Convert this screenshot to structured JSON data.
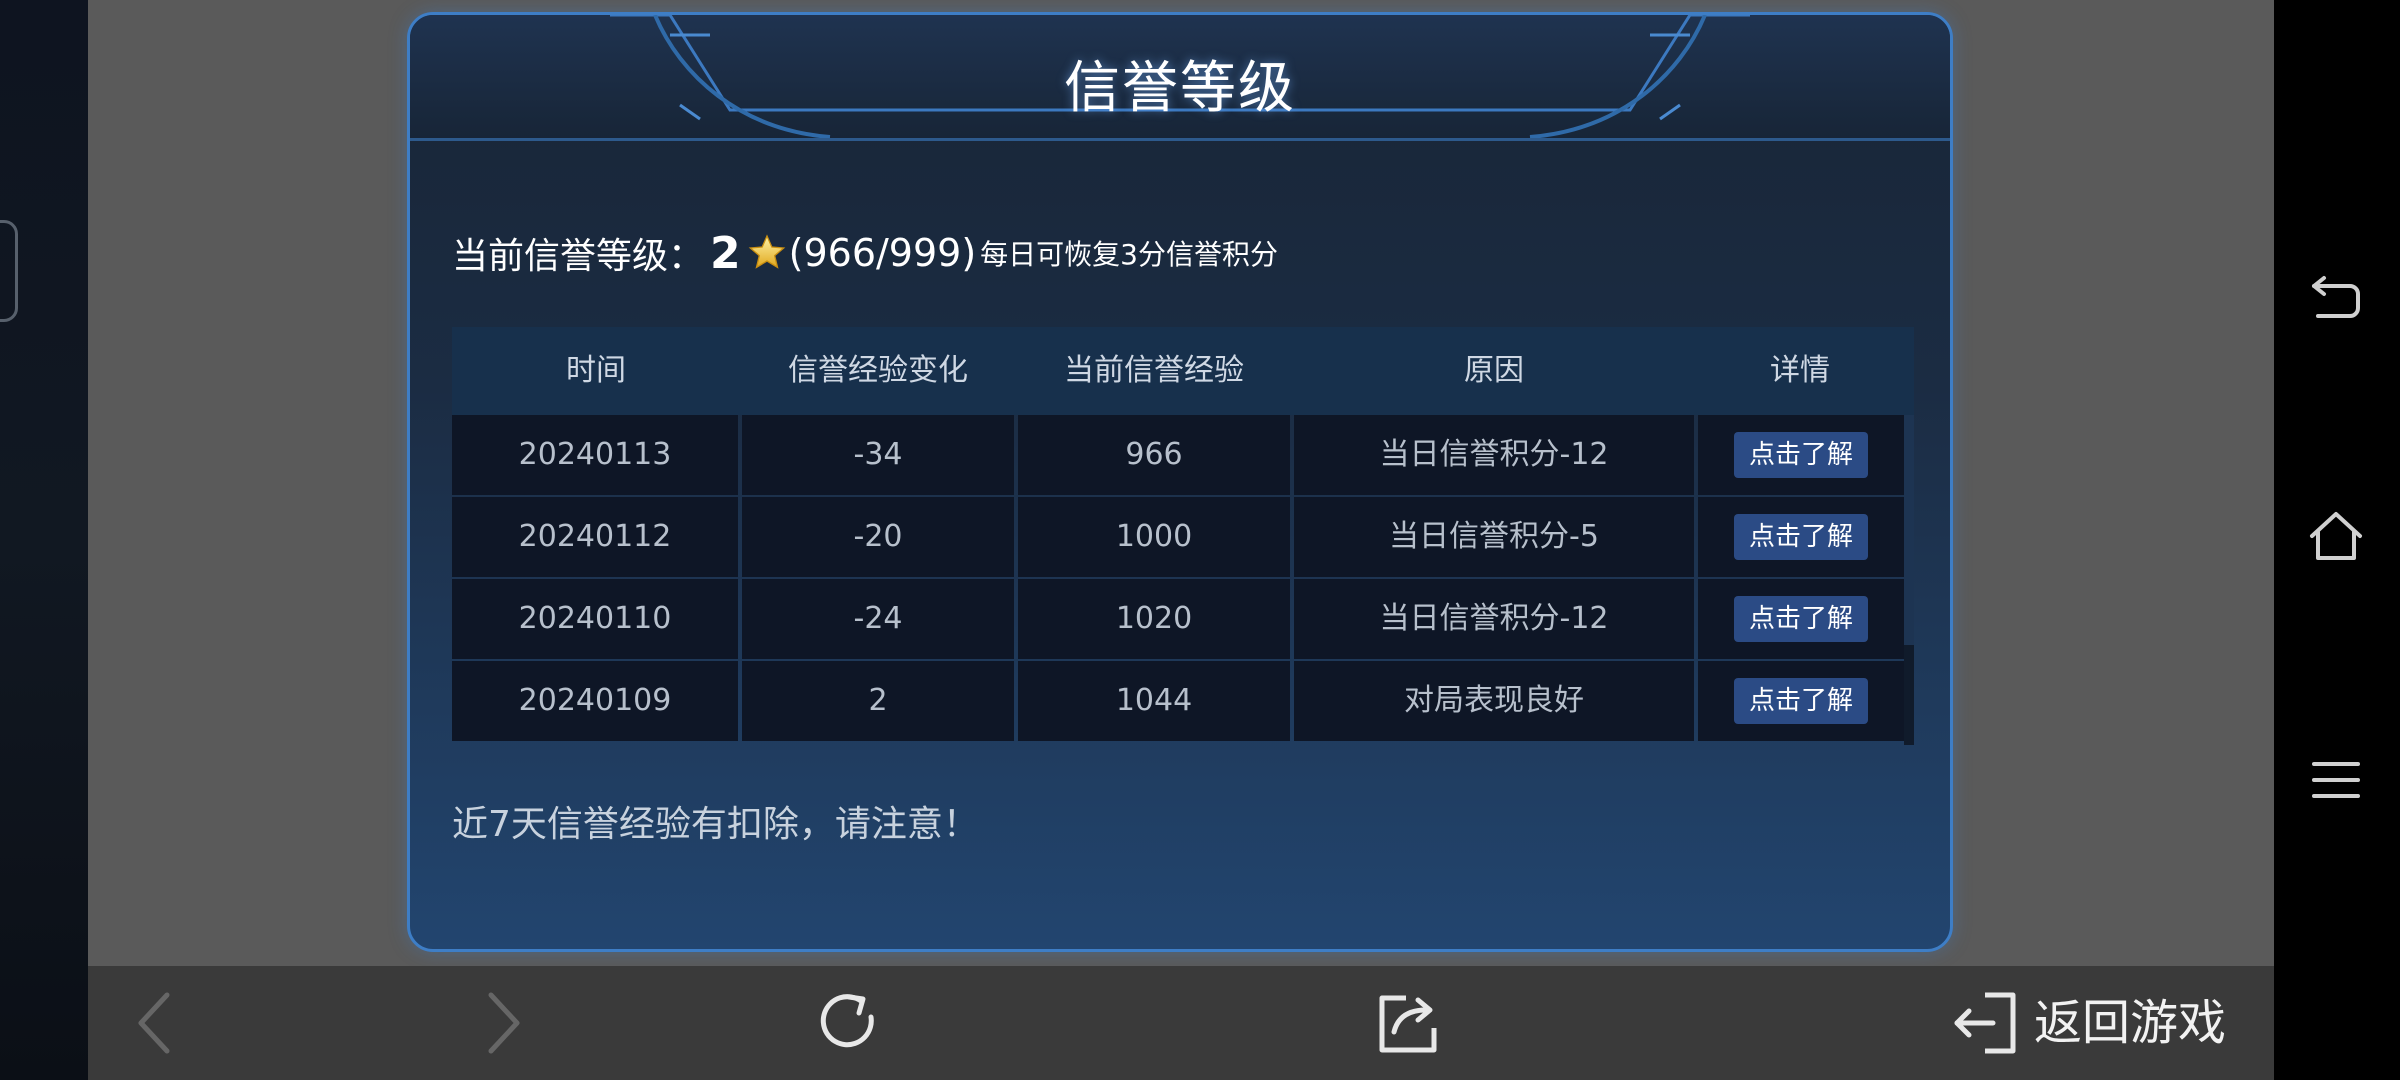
{
  "panel": {
    "title": "信誉等级"
  },
  "level": {
    "label": "当前信誉等级：",
    "value": "2",
    "score": "(966/999)",
    "note": "每日可恢复3分信誉积分"
  },
  "table": {
    "headers": [
      "时间",
      "信誉经验变化",
      "当前信誉经验",
      "原因",
      "详情"
    ],
    "rows": [
      {
        "date": "20240113",
        "change": "-34",
        "current": "966",
        "reason": "当日信誉积分-12",
        "detail": "点击了解"
      },
      {
        "date": "20240112",
        "change": "-20",
        "current": "1000",
        "reason": "当日信誉积分-5",
        "detail": "点击了解"
      },
      {
        "date": "20240110",
        "change": "-24",
        "current": "1020",
        "reason": "当日信誉积分-12",
        "detail": "点击了解"
      },
      {
        "date": "20240109",
        "change": "2",
        "current": "1044",
        "reason": "对局表现良好",
        "detail": "点击了解"
      }
    ]
  },
  "warning": "近7天信誉经验有扣除，请注意！",
  "bottom_bar": {
    "back_icon": "chevron-left-icon",
    "forward_icon": "chevron-right-icon",
    "refresh_icon": "refresh-icon",
    "share_icon": "share-icon",
    "return_icon": "exit-icon",
    "return_label": "返回游戏"
  },
  "system_nav": {
    "back_icon": "back-icon",
    "home_icon": "home-icon",
    "menu_icon": "menu-icon"
  },
  "colors": {
    "accent_border": "#3e7ec6",
    "button_bg": "#2b4b85",
    "bottom_bar_bg": "#3a3a3a"
  }
}
